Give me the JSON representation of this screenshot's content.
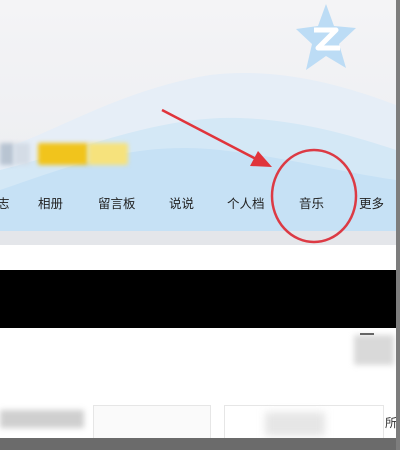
{
  "nav": {
    "items": [
      {
        "label": "志"
      },
      {
        "label": "相册"
      },
      {
        "label": "留言板"
      },
      {
        "label": "说说"
      },
      {
        "label": "个人档"
      },
      {
        "label": "音乐"
      },
      {
        "label": "更多"
      }
    ]
  },
  "content": {
    "right_char": "所"
  },
  "colors": {
    "annotation_red": "#e0343b",
    "nav_background": "#c8e2f5",
    "logo_blue": "#bcdcf5"
  },
  "icons": {
    "logo": "qzone-star-logo",
    "annotation": "red-arrow-and-circle"
  }
}
